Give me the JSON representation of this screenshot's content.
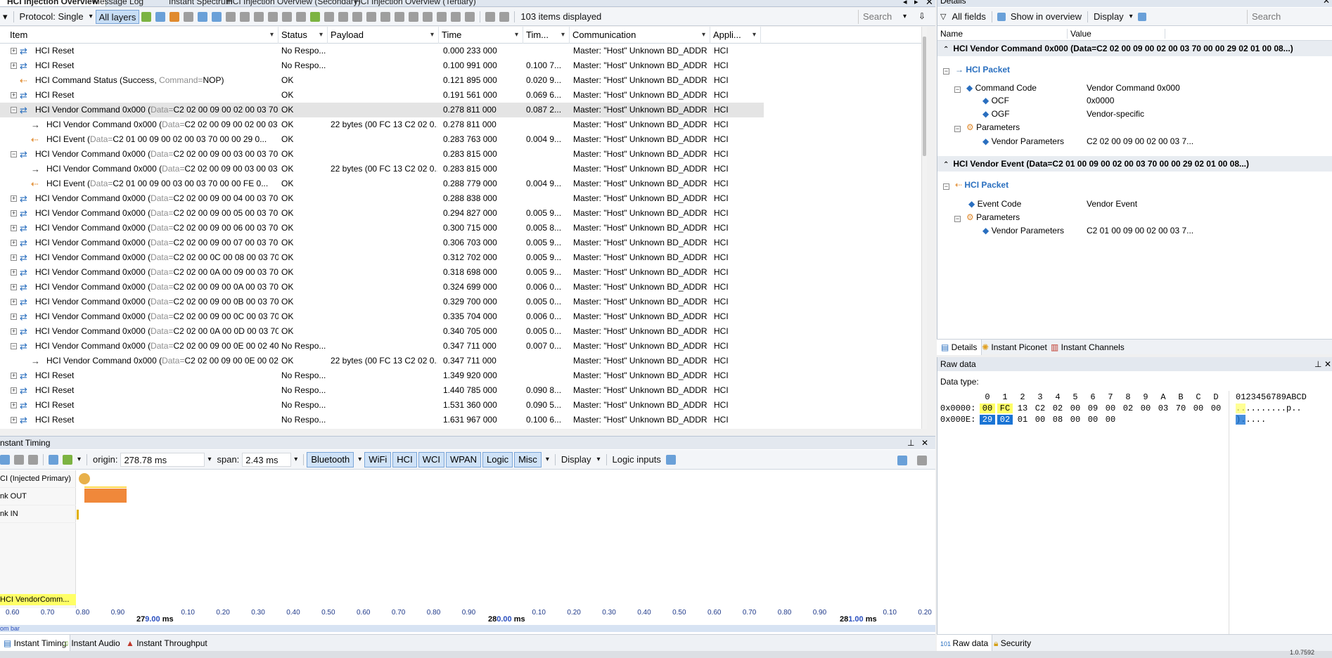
{
  "tabs": [
    {
      "label": "HCI Injection Overview",
      "active": true
    },
    {
      "label": "Message Log"
    },
    {
      "label": "Instant Spectrum"
    },
    {
      "label": "HCI Injection Overview (Secondary)"
    },
    {
      "label": "HCI Injection Overview (Tertiary)"
    }
  ],
  "toolbar": {
    "protocol": "Protocol: Single",
    "all_layers": "All layers",
    "items_count": "103 items displayed",
    "search_placeholder": "Search"
  },
  "columns": [
    {
      "label": "Item"
    },
    {
      "label": "Status"
    },
    {
      "label": "Payload"
    },
    {
      "label": "Time"
    },
    {
      "label": "Tim..."
    },
    {
      "label": "Communication"
    },
    {
      "label": "Appli..."
    }
  ],
  "rows": [
    {
      "expander": "+",
      "icon": "blue",
      "indent": 0,
      "item": "HCI Reset",
      "data": "",
      "status": "No Respo...",
      "payload": "",
      "time": "0.000 233 000",
      "delta": "",
      "comm": "Master: \"Host\" Unknown BD_ADDR ...",
      "app": "HCI"
    },
    {
      "expander": "+",
      "icon": "blue",
      "indent": 0,
      "item": "HCI Reset",
      "data": "",
      "status": "No Respo...",
      "payload": "",
      "time": "0.100 991 000",
      "delta": "0.100 7...",
      "comm": "Master: \"Host\" Unknown BD_ADDR ...",
      "app": "HCI"
    },
    {
      "expander": "",
      "icon": "event",
      "indent": 0,
      "item": "HCI Command Status (Success, ",
      "data": "Command=",
      "dataval": "NOP)",
      "status": "OK",
      "payload": "",
      "time": "0.121 895 000",
      "delta": "0.020 9...",
      "comm": "Master: \"Host\" Unknown BD_ADDR ...",
      "app": "HCI"
    },
    {
      "expander": "+",
      "icon": "blue",
      "indent": 0,
      "item": "HCI Reset",
      "data": "",
      "status": "OK",
      "payload": "",
      "time": "0.191 561 000",
      "delta": "0.069 6...",
      "comm": "Master: \"Host\" Unknown BD_ADDR ...",
      "app": "HCI"
    },
    {
      "expander": "-",
      "icon": "blue",
      "indent": 0,
      "item": "HCI Vendor Command 0x000 (",
      "data": "Data=",
      "dataval": "C2 02 00 09 00 02 00 03 70 00 ...",
      "status": "OK",
      "payload": "",
      "time": "0.278 811 000",
      "delta": "0.087 2...",
      "comm": "Master: \"Host\" Unknown BD_ADDR ...",
      "app": "HCI",
      "selected": true
    },
    {
      "expander": "",
      "icon": "arrow",
      "indent": 1,
      "item": "HCI Vendor Command 0x000 (",
      "data": "Data=",
      "dataval": "C2 02 00 09 00 02 00 03 70 ...",
      "status": "OK",
      "payload": "22 bytes (00 FC 13 C2 02 0...",
      "time": "0.278 811 000",
      "delta": "",
      "comm": "Master: \"Host\" Unknown BD_ADDR ...",
      "app": "HCI"
    },
    {
      "expander": "",
      "icon": "event",
      "indent": 1,
      "item": "HCI Event (",
      "data": "Data=",
      "dataval": "C2 01 00 09 00 02 00 03 70 00 00 29 0...",
      "status": "OK",
      "payload": "",
      "time": "0.283 763 000",
      "delta": "0.004 9...",
      "comm": "Master: \"Host\" Unknown BD_ADDR ...",
      "app": "HCI"
    },
    {
      "expander": "-",
      "icon": "blue",
      "indent": 0,
      "item": "HCI Vendor Command 0x000 (",
      "data": "Data=",
      "dataval": "C2 02 00 09 00 03 00 03 70 00 ...",
      "status": "OK",
      "payload": "",
      "time": "0.283 815 000",
      "delta": "",
      "comm": "Master: \"Host\" Unknown BD_ADDR ...",
      "app": "HCI"
    },
    {
      "expander": "",
      "icon": "arrow",
      "indent": 1,
      "item": "HCI Vendor Command 0x000 (",
      "data": "Data=",
      "dataval": "C2 02 00 09 00 03 00 03 70 ...",
      "status": "OK",
      "payload": "22 bytes (00 FC 13 C2 02 0...",
      "time": "0.283 815 000",
      "delta": "",
      "comm": "Master: \"Host\" Unknown BD_ADDR ...",
      "app": "HCI"
    },
    {
      "expander": "",
      "icon": "event",
      "indent": 1,
      "item": "HCI Event (",
      "data": "Data=",
      "dataval": "C2 01 00 09 00 03 00 03 70 00 00 FE 0...",
      "status": "OK",
      "payload": "",
      "time": "0.288 779 000",
      "delta": "0.004 9...",
      "comm": "Master: \"Host\" Unknown BD_ADDR ...",
      "app": "HCI"
    },
    {
      "expander": "+",
      "icon": "blue",
      "indent": 0,
      "item": "HCI Vendor Command 0x000 (",
      "data": "Data=",
      "dataval": "C2 02 00 09 00 04 00 03 70 00 ...",
      "status": "OK",
      "payload": "",
      "time": "0.288 838 000",
      "delta": "",
      "comm": "Master: \"Host\" Unknown BD_ADDR ...",
      "app": "HCI"
    },
    {
      "expander": "+",
      "icon": "blue",
      "indent": 0,
      "item": "HCI Vendor Command 0x000 (",
      "data": "Data=",
      "dataval": "C2 02 00 09 00 05 00 03 70 00 ...",
      "status": "OK",
      "payload": "",
      "time": "0.294 827 000",
      "delta": "0.005 9...",
      "comm": "Master: \"Host\" Unknown BD_ADDR ...",
      "app": "HCI"
    },
    {
      "expander": "+",
      "icon": "blue",
      "indent": 0,
      "item": "HCI Vendor Command 0x000 (",
      "data": "Data=",
      "dataval": "C2 02 00 09 00 06 00 03 70 00 ...",
      "status": "OK",
      "payload": "",
      "time": "0.300 715 000",
      "delta": "0.005 8...",
      "comm": "Master: \"Host\" Unknown BD_ADDR ...",
      "app": "HCI"
    },
    {
      "expander": "+",
      "icon": "blue",
      "indent": 0,
      "item": "HCI Vendor Command 0x000 (",
      "data": "Data=",
      "dataval": "C2 02 00 09 00 07 00 03 70 00 ...",
      "status": "OK",
      "payload": "",
      "time": "0.306 703 000",
      "delta": "0.005 9...",
      "comm": "Master: \"Host\" Unknown BD_ADDR ...",
      "app": "HCI"
    },
    {
      "expander": "+",
      "icon": "blue",
      "indent": 0,
      "item": "HCI Vendor Command 0x000 (",
      "data": "Data=",
      "dataval": "C2 02 00 0C 00 08 00 03 70 00 ...",
      "status": "OK",
      "payload": "",
      "time": "0.312 702 000",
      "delta": "0.005 9...",
      "comm": "Master: \"Host\" Unknown BD_ADDR ...",
      "app": "HCI"
    },
    {
      "expander": "+",
      "icon": "blue",
      "indent": 0,
      "item": "HCI Vendor Command 0x000 (",
      "data": "Data=",
      "dataval": "C2 02 00 0A 00 09 00 03 70 00 ...",
      "status": "OK",
      "payload": "",
      "time": "0.318 698 000",
      "delta": "0.005 9...",
      "comm": "Master: \"Host\" Unknown BD_ADDR ...",
      "app": "HCI"
    },
    {
      "expander": "+",
      "icon": "blue",
      "indent": 0,
      "item": "HCI Vendor Command 0x000 (",
      "data": "Data=",
      "dataval": "C2 02 00 09 00 0A 00 03 70 00 ...",
      "status": "OK",
      "payload": "",
      "time": "0.324 699 000",
      "delta": "0.006 0...",
      "comm": "Master: \"Host\" Unknown BD_ADDR ...",
      "app": "HCI"
    },
    {
      "expander": "+",
      "icon": "blue",
      "indent": 0,
      "item": "HCI Vendor Command 0x000 (",
      "data": "Data=",
      "dataval": "C2 02 00 09 00 0B 00 03 70 00 ...",
      "status": "OK",
      "payload": "",
      "time": "0.329 700 000",
      "delta": "0.005 0...",
      "comm": "Master: \"Host\" Unknown BD_ADDR ...",
      "app": "HCI"
    },
    {
      "expander": "+",
      "icon": "blue",
      "indent": 0,
      "item": "HCI Vendor Command 0x000 (",
      "data": "Data=",
      "dataval": "C2 02 00 09 00 0C 00 03 70 00 ...",
      "status": "OK",
      "payload": "",
      "time": "0.335 704 000",
      "delta": "0.006 0...",
      "comm": "Master: \"Host\" Unknown BD_ADDR ...",
      "app": "HCI"
    },
    {
      "expander": "+",
      "icon": "blue",
      "indent": 0,
      "item": "HCI Vendor Command 0x000 (",
      "data": "Data=",
      "dataval": "C2 02 00 0A 00 0D 00 03 70 00 ...",
      "status": "OK",
      "payload": "",
      "time": "0.340 705 000",
      "delta": "0.005 0...",
      "comm": "Master: \"Host\" Unknown BD_ADDR ...",
      "app": "HCI"
    },
    {
      "expander": "-",
      "icon": "blue",
      "indent": 0,
      "item": "HCI Vendor Command 0x000 (",
      "data": "Data=",
      "dataval": "C2 02 00 09 00 0E 00 02 40 00 ...",
      "status": "No Respo...",
      "payload": "",
      "time": "0.347 711 000",
      "delta": "0.007 0...",
      "comm": "Master: \"Host\" Unknown BD_ADDR ...",
      "app": "HCI"
    },
    {
      "expander": "",
      "icon": "arrow",
      "indent": 1,
      "item": "HCI Vendor Command 0x000 (",
      "data": "Data=",
      "dataval": "C2 02 00 09 00 0E 00 02 40 ...",
      "status": "OK",
      "payload": "22 bytes (00 FC 13 C2 02 0...",
      "time": "0.347 711 000",
      "delta": "",
      "comm": "Master: \"Host\" Unknown BD_ADDR ...",
      "app": "HCI"
    },
    {
      "expander": "+",
      "icon": "blue",
      "indent": 0,
      "item": "HCI Reset",
      "data": "",
      "status": "No Respo...",
      "payload": "",
      "time": "1.349 920 000",
      "delta": "",
      "comm": "Master: \"Host\" Unknown BD_ADDR ...",
      "app": "HCI"
    },
    {
      "expander": "+",
      "icon": "blue",
      "indent": 0,
      "item": "HCI Reset",
      "data": "",
      "status": "No Respo...",
      "payload": "",
      "time": "1.440 785 000",
      "delta": "0.090 8...",
      "comm": "Master: \"Host\" Unknown BD_ADDR ...",
      "app": "HCI"
    },
    {
      "expander": "+",
      "icon": "blue",
      "indent": 0,
      "item": "HCI Reset",
      "data": "",
      "status": "No Respo...",
      "payload": "",
      "time": "1.531 360 000",
      "delta": "0.090 5...",
      "comm": "Master: \"Host\" Unknown BD_ADDR ...",
      "app": "HCI"
    },
    {
      "expander": "+",
      "icon": "blue",
      "indent": 0,
      "item": "HCI Reset",
      "data": "",
      "status": "No Respo...",
      "payload": "",
      "time": "1.631 967 000",
      "delta": "0.100 6...",
      "comm": "Master: \"Host\" Unknown BD_ADDR ...",
      "app": "HCI"
    }
  ],
  "details": {
    "title": "Details",
    "all_fields": "All fields",
    "show_in_overview": "Show in overview",
    "display": "Display",
    "search_placeholder": "Search",
    "col_name": "Name",
    "col_value": "Value",
    "cmd_header": "HCI Vendor Command 0x000 (Data=C2 02 00 09 00 02 00 03 70 00 00 29 02 01 00 08...)",
    "cmd_packet": "HCI Packet",
    "command_code": "Command Code",
    "command_code_val": "Vendor Command 0x000",
    "ocf": "OCF",
    "ocf_val": "0x0000",
    "ogf": "OGF",
    "ogf_val": "Vendor-specific",
    "parameters": "Parameters",
    "vendor_params": "Vendor Parameters",
    "vendor_params_val": "C2 02 00 09 00 02 00 03 7...",
    "evt_header": "HCI Vendor Event (Data=C2 01 00 09 00 02 00 03 70 00 00 29 02 01 00 08...)",
    "evt_packet": "HCI Packet",
    "event_code": "Event Code",
    "event_code_val": "Vendor Event",
    "evt_parameters": "Parameters",
    "evt_vendor_params": "Vendor Parameters",
    "evt_vendor_params_val": "C2 01 00 09 00 02 00 03 7...",
    "tabs": [
      "Details",
      "Instant Piconet",
      "Instant Channels"
    ]
  },
  "raw": {
    "title": "Raw data",
    "data_type": "Data type:",
    "cols": [
      "0",
      "1",
      "2",
      "3",
      "4",
      "5",
      "6",
      "7",
      "8",
      "9",
      "A",
      "B",
      "C",
      "D"
    ],
    "ascii_header": "0123456789ABCD",
    "rows": [
      {
        "addr": "0x0000:",
        "bytes": [
          "00",
          "FC",
          "13",
          "C2",
          "02",
          "00",
          "09",
          "00",
          "02",
          "00",
          "03",
          "70",
          "00",
          "00"
        ],
        "ascii": "..........p.."
      },
      {
        "addr": "0x000E:",
        "bytes": [
          "29",
          "02",
          "01",
          "00",
          "08",
          "00",
          "00",
          "00"
        ],
        "ascii": ").....",
        "ascii_hl": ")."
      }
    ]
  },
  "timing": {
    "title": "Instant Timing",
    "origin_label": "origin:",
    "origin": "278.78 ms",
    "span_label": "span:",
    "span": "2.43 ms",
    "chips": [
      "Bluetooth",
      "WiFi",
      "HCI",
      "WCI",
      "WPAN",
      "Logic",
      "Misc"
    ],
    "display": "Display",
    "logic_inputs": "Logic inputs",
    "lanes": [
      "CI (Injected Primary)",
      "nk OUT",
      "nk IN"
    ],
    "tooltip": "HCI VendorComm...",
    "ticks": [
      "0.60",
      "0.70",
      "0.80",
      "0.90",
      "279.00",
      "0.10",
      "0.20",
      "0.30",
      "0.40",
      "0.50",
      "0.60",
      "0.70",
      "0.80",
      "0.90",
      "280.00",
      "0.10",
      "0.20",
      "0.30",
      "0.40",
      "0.50",
      "0.60",
      "0.70",
      "0.80",
      "0.90",
      "281.00",
      "0.10",
      "0.20"
    ],
    "major": [
      {
        "big": "27",
        "ms": "9.00",
        "unit": "ms"
      },
      {
        "big": "28",
        "ms": "0.00",
        "unit": "ms"
      },
      {
        "big": "28",
        "ms": "1.00",
        "unit": "ms"
      }
    ],
    "zoom_bar": "om bar"
  },
  "bottom_tabs": [
    "Instant Timing",
    "Instant Audio",
    "Instant Throughput"
  ],
  "right_bottom_tabs": [
    "Raw data",
    "Security"
  ],
  "status": {
    "version": "1.0.7592"
  },
  "colors": {
    "accent": "#2a6fbf",
    "highlight": "#ffff66",
    "selection": "#1a74d4",
    "orange": "#f0883a"
  }
}
